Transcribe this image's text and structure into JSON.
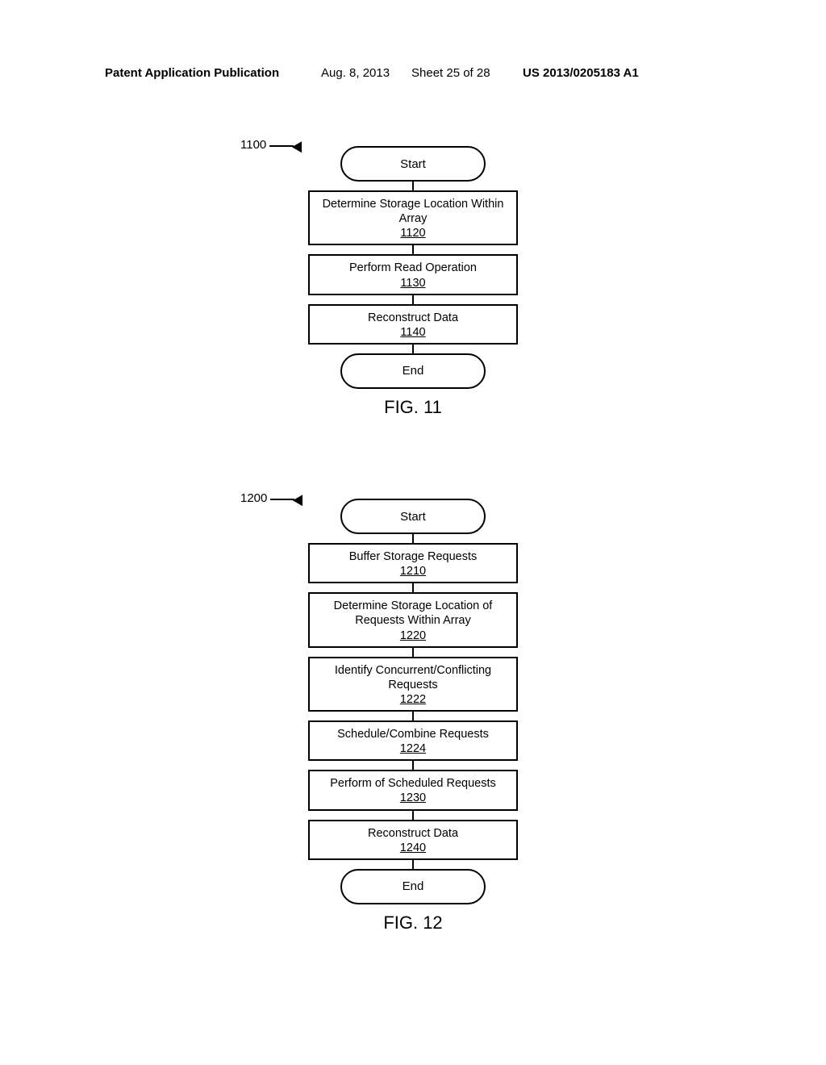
{
  "header": {
    "publication": "Patent Application Publication",
    "date": "Aug. 8, 2013",
    "sheet": "Sheet 25 of 28",
    "docnum": "US 2013/0205183 A1"
  },
  "fig11": {
    "ref_label": "1100",
    "start": "Start",
    "step1": {
      "text": "Determine Storage Location Within Array",
      "ref": "1120"
    },
    "step2": {
      "text": "Perform Read Operation",
      "ref": "1130"
    },
    "step3": {
      "text": "Reconstruct Data",
      "ref": "1140"
    },
    "end": "End",
    "caption": "FIG. 11"
  },
  "fig12": {
    "ref_label": "1200",
    "start": "Start",
    "step1": {
      "text": "Buffer Storage Requests",
      "ref": "1210"
    },
    "step2": {
      "text": "Determine Storage Location of Requests Within Array",
      "ref": "1220"
    },
    "step3": {
      "text": "Identify Concurrent/Conflicting Requests",
      "ref": "1222"
    },
    "step4": {
      "text": "Schedule/Combine Requests",
      "ref": "1224"
    },
    "step5": {
      "text": "Perform of Scheduled Requests",
      "ref": "1230"
    },
    "step6": {
      "text": "Reconstruct Data",
      "ref": "1240"
    },
    "end": "End",
    "caption": "FIG. 12"
  }
}
